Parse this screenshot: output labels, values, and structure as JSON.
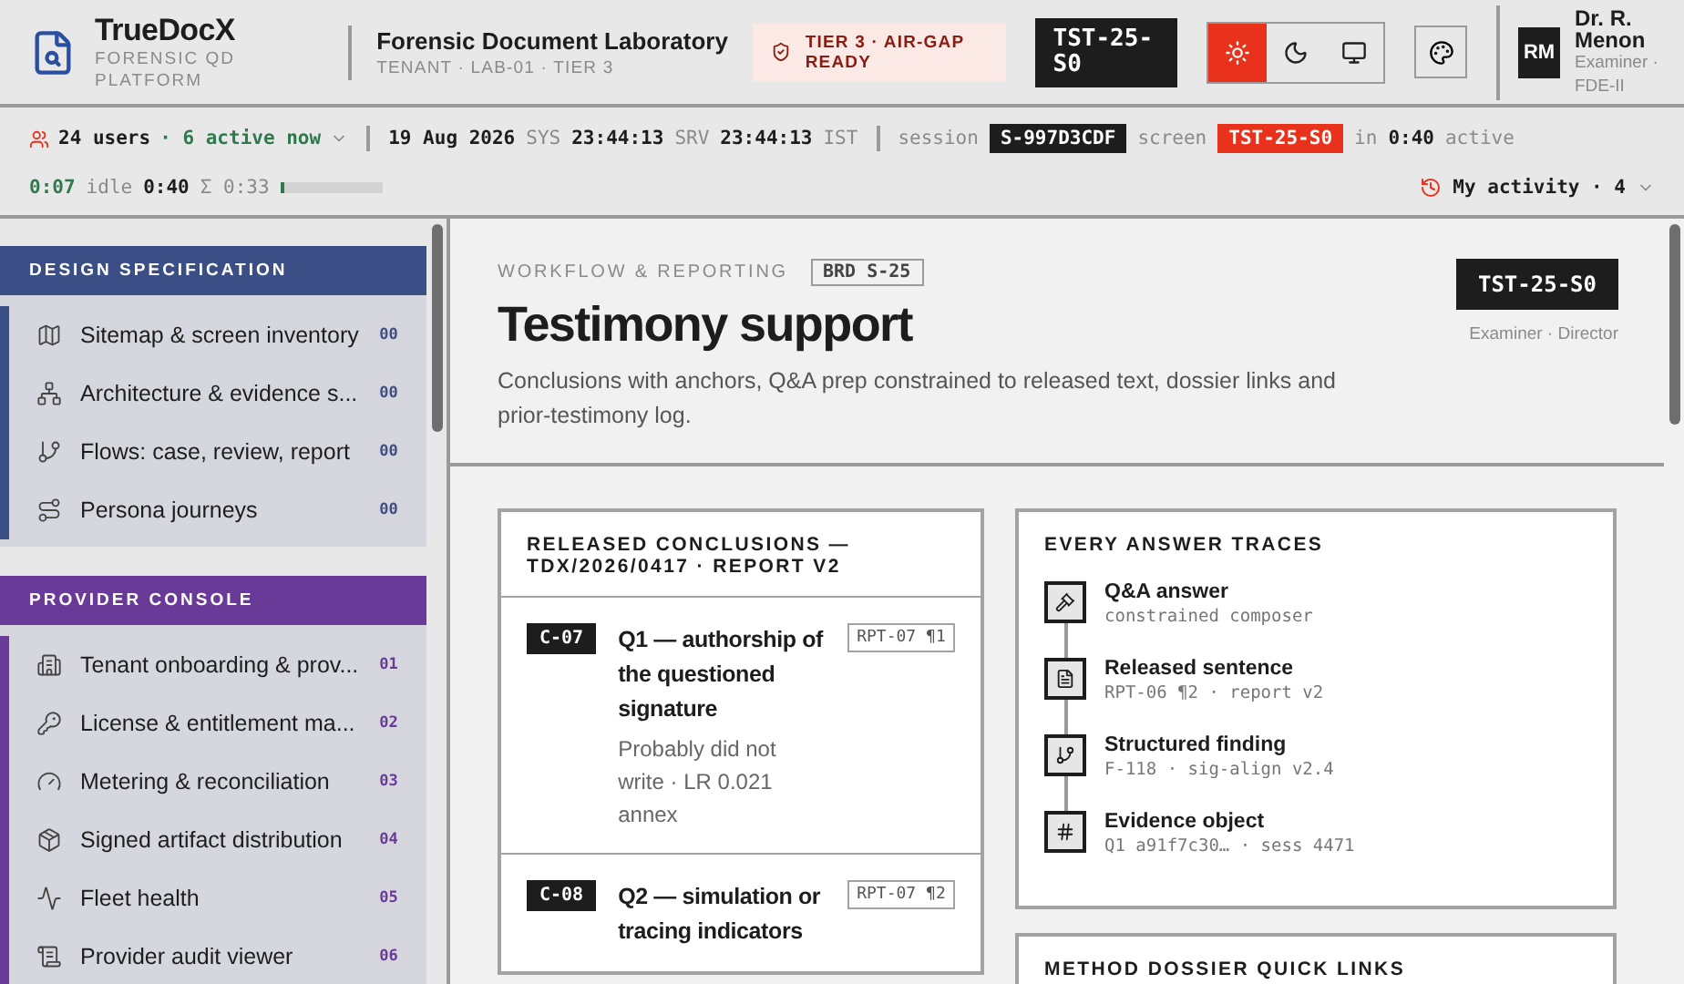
{
  "brand": {
    "name": "TrueDocX",
    "tagline": "FORENSIC QD PLATFORM"
  },
  "tenant": {
    "name": "Forensic Document Laboratory",
    "meta": "TENANT · LAB-01 · TIER 3"
  },
  "tier_badge": "TIER 3 · AIR-GAP READY",
  "screen_code": "TST-25-S0",
  "theme_modes": [
    {
      "kind": "light",
      "selected": true
    },
    {
      "kind": "dark",
      "selected": false
    },
    {
      "kind": "system",
      "selected": false
    }
  ],
  "user": {
    "initials": "RM",
    "name": "Dr. R. Menon",
    "role": "Examiner · FDE-II"
  },
  "status_bar": {
    "users": "24 users",
    "active": "· 6 active now",
    "date": "19 Aug 2026",
    "sys_label": "SYS",
    "sys_time": "23:44:13",
    "srv_label": "SRV",
    "srv_time": "23:44:13",
    "tz": "IST",
    "session_label": "session",
    "session": "S-997D3CDF",
    "screen_label": "screen",
    "screen": "TST-25-S0",
    "in_label": "in",
    "in_time": "0:40",
    "active_label": "active",
    "active_time": "0:07",
    "idle_label": "idle",
    "idle_time": "0:40",
    "sum": "Σ 0:33",
    "level": 0.04,
    "activity": "My activity · 4"
  },
  "sidebar": {
    "sections": [
      {
        "title": "DESIGN SPECIFICATION",
        "color": "#3b4f86",
        "items": [
          {
            "label": "Sitemap & screen inventory",
            "count": "00"
          },
          {
            "label": "Architecture & evidence s...",
            "count": "00"
          },
          {
            "label": "Flows: case, review, report",
            "count": "00"
          },
          {
            "label": "Persona journeys",
            "count": "00"
          }
        ]
      },
      {
        "title": "PROVIDER CONSOLE",
        "color": "#6a3a98",
        "items": [
          {
            "label": "Tenant onboarding & prov...",
            "count": "01"
          },
          {
            "label": "License & entitlement ma...",
            "count": "02"
          },
          {
            "label": "Metering & reconciliation",
            "count": "03"
          },
          {
            "label": "Signed artifact distribution",
            "count": "04"
          },
          {
            "label": "Fleet health",
            "count": "05"
          },
          {
            "label": "Provider audit viewer",
            "count": "06"
          }
        ]
      }
    ]
  },
  "page": {
    "eyebrow": "WORKFLOW & REPORTING",
    "brd": "BRD S-25",
    "title": "Testimony support",
    "description": "Conclusions with anchors, Q&A prep constrained to released text, dossier links and prior-testimony log.",
    "code": "TST-25-S0",
    "roles": "Examiner · Director"
  },
  "conclusions": {
    "title": "RELEASED CONCLUSIONS — TDX/2026/0417 · REPORT V2",
    "rows": [
      {
        "id": "C-07",
        "question": "Q1 — authorship of the questioned signature",
        "detail": "Probably did not write · LR 0.021 annex",
        "ref": "RPT-07 ¶1"
      },
      {
        "id": "C-08",
        "question": "Q2 — simulation or tracing indicators",
        "ref": "RPT-07 ¶2"
      }
    ]
  },
  "traces": {
    "title": "EVERY ANSWER TRACES",
    "steps": [
      {
        "title": "Q&A answer",
        "sub": "constrained composer"
      },
      {
        "title": "Released sentence",
        "sub": "RPT-06 ¶2 · report v2"
      },
      {
        "title": "Structured finding",
        "sub": "F-118 · sig-align v2.4"
      },
      {
        "title": "Evidence object",
        "sub": "Q1 a91f7c30… · sess 4471"
      }
    ]
  },
  "dossier": {
    "title": "METHOD DOSSIER QUICK LINKS"
  }
}
